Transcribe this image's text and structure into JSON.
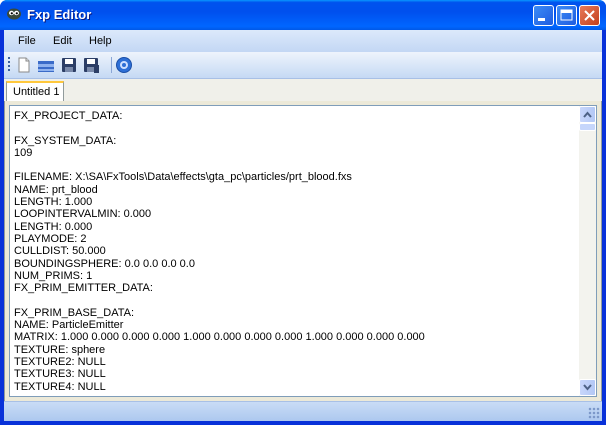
{
  "window": {
    "title": "Fxp Editor",
    "accent": "#0054e3"
  },
  "menu": {
    "file": "File",
    "edit": "Edit",
    "help": "Help"
  },
  "toolbar": {
    "icons": [
      "new-file-icon",
      "open-icon",
      "save-icon",
      "save-all-icon",
      "help-icon"
    ]
  },
  "tabs": [
    {
      "label": "Untitled 1",
      "selected": true
    }
  ],
  "editor": {
    "lines": [
      "FX_PROJECT_DATA:",
      "",
      "FX_SYSTEM_DATA:",
      "109",
      "",
      "FILENAME: X:\\SA\\FxTools\\Data\\effects\\gta_pc\\particles/prt_blood.fxs",
      "NAME: prt_blood",
      "LENGTH: 1.000",
      "LOOPINTERVALMIN: 0.000",
      "LENGTH: 0.000",
      "PLAYMODE: 2",
      "CULLDIST: 50.000",
      "BOUNDINGSPHERE: 0.0 0.0 0.0 0.0",
      "NUM_PRIMS: 1",
      "FX_PRIM_EMITTER_DATA:",
      "",
      "FX_PRIM_BASE_DATA:",
      "NAME: ParticleEmitter",
      "MATRIX: 1.000 0.000 0.000 0.000 1.000 0.000 0.000 0.000 1.000 0.000 0.000 0.000",
      "TEXTURE: sphere",
      "TEXTURE2: NULL",
      "TEXTURE3: NULL",
      "TEXTURE4: NULL"
    ]
  }
}
